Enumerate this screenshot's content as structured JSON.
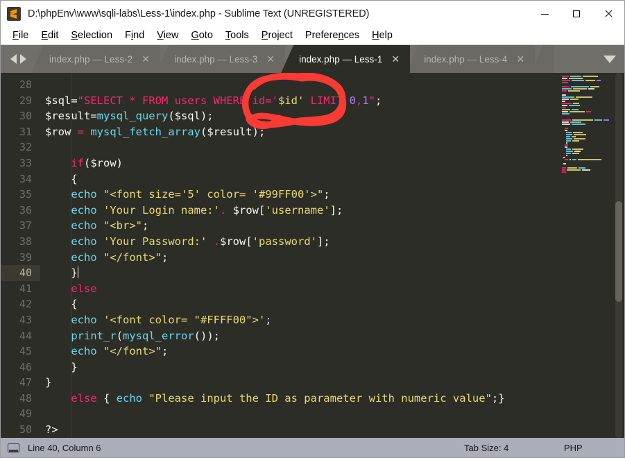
{
  "window": {
    "title": "D:\\phpEnv\\www\\sqli-labs\\Less-1\\index.php - Sublime Text (UNREGISTERED)",
    "app_icon": "sublime-text-icon",
    "minimize_label": "—",
    "maximize_label": "□",
    "close_label": "✕"
  },
  "menubar": {
    "items": [
      {
        "label": "File",
        "accel": "F"
      },
      {
        "label": "Edit",
        "accel": "E"
      },
      {
        "label": "Selection",
        "accel": "S"
      },
      {
        "label": "Find",
        "accel": "i"
      },
      {
        "label": "View",
        "accel": "V"
      },
      {
        "label": "Goto",
        "accel": "G"
      },
      {
        "label": "Tools",
        "accel": "T"
      },
      {
        "label": "Project",
        "accel": "P"
      },
      {
        "label": "Preferences",
        "accel": "n"
      },
      {
        "label": "Help",
        "accel": "H"
      }
    ]
  },
  "tabbar": {
    "nav_prev": "◀",
    "nav_next": "▶",
    "dropdown": "▼",
    "close_glyph": "✕",
    "tabs": [
      {
        "label": "index.php — Less-2",
        "active": false
      },
      {
        "label": "index.php — Less-3",
        "active": false
      },
      {
        "label": "index.php — Less-1",
        "active": true
      },
      {
        "label": "index.php — Less-4",
        "active": false
      },
      {
        "label": "",
        "active": false,
        "partial": true
      }
    ]
  },
  "editor": {
    "active_line": 40,
    "first_line": 28,
    "lines": [
      {
        "n": 28,
        "tokens": []
      },
      {
        "n": 29,
        "tokens": [
          {
            "t": "$sql=",
            "c": "plain"
          },
          {
            "t": "\"SELECT * FROM users WHERE id='",
            "c": "kw"
          },
          {
            "t": "$id",
            "c": "str"
          },
          {
            "t": "' ",
            "c": "str"
          },
          {
            "t": "LIMIT ",
            "c": "kw"
          },
          {
            "t": "0",
            "c": "num"
          },
          {
            "t": ",",
            "c": "kw"
          },
          {
            "t": "1",
            "c": "num"
          },
          {
            "t": "\"",
            "c": "kw"
          },
          {
            "t": ";",
            "c": "plain"
          }
        ]
      },
      {
        "n": 30,
        "tokens": [
          {
            "t": "$result=",
            "c": "plain"
          },
          {
            "t": "mysql_query",
            "c": "fn"
          },
          {
            "t": "($sql);",
            "c": "plain"
          }
        ]
      },
      {
        "n": 31,
        "tokens": [
          {
            "t": "$row ",
            "c": "plain"
          },
          {
            "t": "= ",
            "c": "kw"
          },
          {
            "t": "mysql_fetch_array",
            "c": "fn"
          },
          {
            "t": "($result);",
            "c": "plain"
          }
        ]
      },
      {
        "n": 32,
        "tokens": []
      },
      {
        "n": 33,
        "tokens": [
          {
            "t": "    ",
            "c": "plain"
          },
          {
            "t": "if",
            "c": "kw"
          },
          {
            "t": "($row)",
            "c": "plain"
          }
        ]
      },
      {
        "n": 34,
        "tokens": [
          {
            "t": "    {",
            "c": "plain"
          }
        ]
      },
      {
        "n": 35,
        "tokens": [
          {
            "t": "    ",
            "c": "plain"
          },
          {
            "t": "echo",
            "c": "fn"
          },
          {
            "t": " ",
            "c": "plain"
          },
          {
            "t": "\"<font size='5' color= '#99FF00'>\"",
            "c": "str"
          },
          {
            "t": ";",
            "c": "plain"
          }
        ]
      },
      {
        "n": 36,
        "tokens": [
          {
            "t": "    ",
            "c": "plain"
          },
          {
            "t": "echo",
            "c": "fn"
          },
          {
            "t": " ",
            "c": "plain"
          },
          {
            "t": "'Your Login name:'",
            "c": "str"
          },
          {
            "t": ".",
            "c": "op"
          },
          {
            "t": " $row[",
            "c": "plain"
          },
          {
            "t": "'username'",
            "c": "str"
          },
          {
            "t": "];",
            "c": "plain"
          }
        ]
      },
      {
        "n": 37,
        "tokens": [
          {
            "t": "    ",
            "c": "plain"
          },
          {
            "t": "echo",
            "c": "fn"
          },
          {
            "t": " ",
            "c": "plain"
          },
          {
            "t": "\"<br>\"",
            "c": "str"
          },
          {
            "t": ";",
            "c": "plain"
          }
        ]
      },
      {
        "n": 38,
        "tokens": [
          {
            "t": "    ",
            "c": "plain"
          },
          {
            "t": "echo",
            "c": "fn"
          },
          {
            "t": " ",
            "c": "plain"
          },
          {
            "t": "'Your Password:'",
            "c": "str"
          },
          {
            "t": " ",
            "c": "plain"
          },
          {
            "t": ".",
            "c": "op"
          },
          {
            "t": "$row[",
            "c": "plain"
          },
          {
            "t": "'password'",
            "c": "str"
          },
          {
            "t": "];",
            "c": "plain"
          }
        ]
      },
      {
        "n": 39,
        "tokens": [
          {
            "t": "    ",
            "c": "plain"
          },
          {
            "t": "echo",
            "c": "fn"
          },
          {
            "t": " ",
            "c": "plain"
          },
          {
            "t": "\"</font>\"",
            "c": "str"
          },
          {
            "t": ";",
            "c": "plain"
          }
        ]
      },
      {
        "n": 40,
        "tokens": [
          {
            "t": "    }",
            "c": "plain"
          }
        ],
        "cursor_after": true
      },
      {
        "n": 41,
        "tokens": [
          {
            "t": "    ",
            "c": "plain"
          },
          {
            "t": "else",
            "c": "kw"
          }
        ]
      },
      {
        "n": 42,
        "tokens": [
          {
            "t": "    {",
            "c": "plain"
          }
        ]
      },
      {
        "n": 43,
        "tokens": [
          {
            "t": "    ",
            "c": "plain"
          },
          {
            "t": "echo",
            "c": "fn"
          },
          {
            "t": " ",
            "c": "plain"
          },
          {
            "t": "'<font color= \"#FFFF00\">'",
            "c": "str"
          },
          {
            "t": ";",
            "c": "plain"
          }
        ]
      },
      {
        "n": 44,
        "tokens": [
          {
            "t": "    ",
            "c": "plain"
          },
          {
            "t": "print_r",
            "c": "fn"
          },
          {
            "t": "(",
            "c": "plain"
          },
          {
            "t": "mysql_error",
            "c": "fn"
          },
          {
            "t": "());",
            "c": "plain"
          }
        ]
      },
      {
        "n": 45,
        "tokens": [
          {
            "t": "    ",
            "c": "plain"
          },
          {
            "t": "echo",
            "c": "fn"
          },
          {
            "t": " ",
            "c": "plain"
          },
          {
            "t": "\"</font>\"",
            "c": "str"
          },
          {
            "t": ";",
            "c": "plain"
          }
        ]
      },
      {
        "n": 46,
        "tokens": [
          {
            "t": "    }",
            "c": "plain"
          }
        ]
      },
      {
        "n": 47,
        "tokens": [
          {
            "t": "}",
            "c": "plain"
          }
        ]
      },
      {
        "n": 48,
        "tokens": [
          {
            "t": "    ",
            "c": "plain"
          },
          {
            "t": "else",
            "c": "kw"
          },
          {
            "t": " { ",
            "c": "plain"
          },
          {
            "t": "echo",
            "c": "fn"
          },
          {
            "t": " ",
            "c": "plain"
          },
          {
            "t": "\"Please input the ID as parameter with numeric value\"",
            "c": "str"
          },
          {
            "t": ";}",
            "c": "plain"
          }
        ]
      },
      {
        "n": 49,
        "tokens": []
      },
      {
        "n": 50,
        "tokens": [
          {
            "t": "?>",
            "c": "plain"
          }
        ]
      }
    ]
  },
  "annotation": {
    "type": "hand-drawn-red-circle",
    "color": "#fa3a35",
    "encircled_text": "id='$id'"
  },
  "statusbar": {
    "icon": "monitor-icon",
    "cursor_position": "Line 40, Column 6",
    "tab_size": "Tab Size: 4",
    "syntax": "PHP"
  },
  "theme": {
    "editor_bg": "#2d2d27",
    "gutter_fg": "#6f6e68",
    "active_line_gutter_bg": "#3b3a32",
    "keyword": "#f92672",
    "string": "#e6db74",
    "function": "#66d9ef",
    "number": "#ae81ff",
    "text": "#f8f8f2",
    "tabbar_bg": "#706f6a",
    "statusbar_bg": "#a9aeb8"
  }
}
